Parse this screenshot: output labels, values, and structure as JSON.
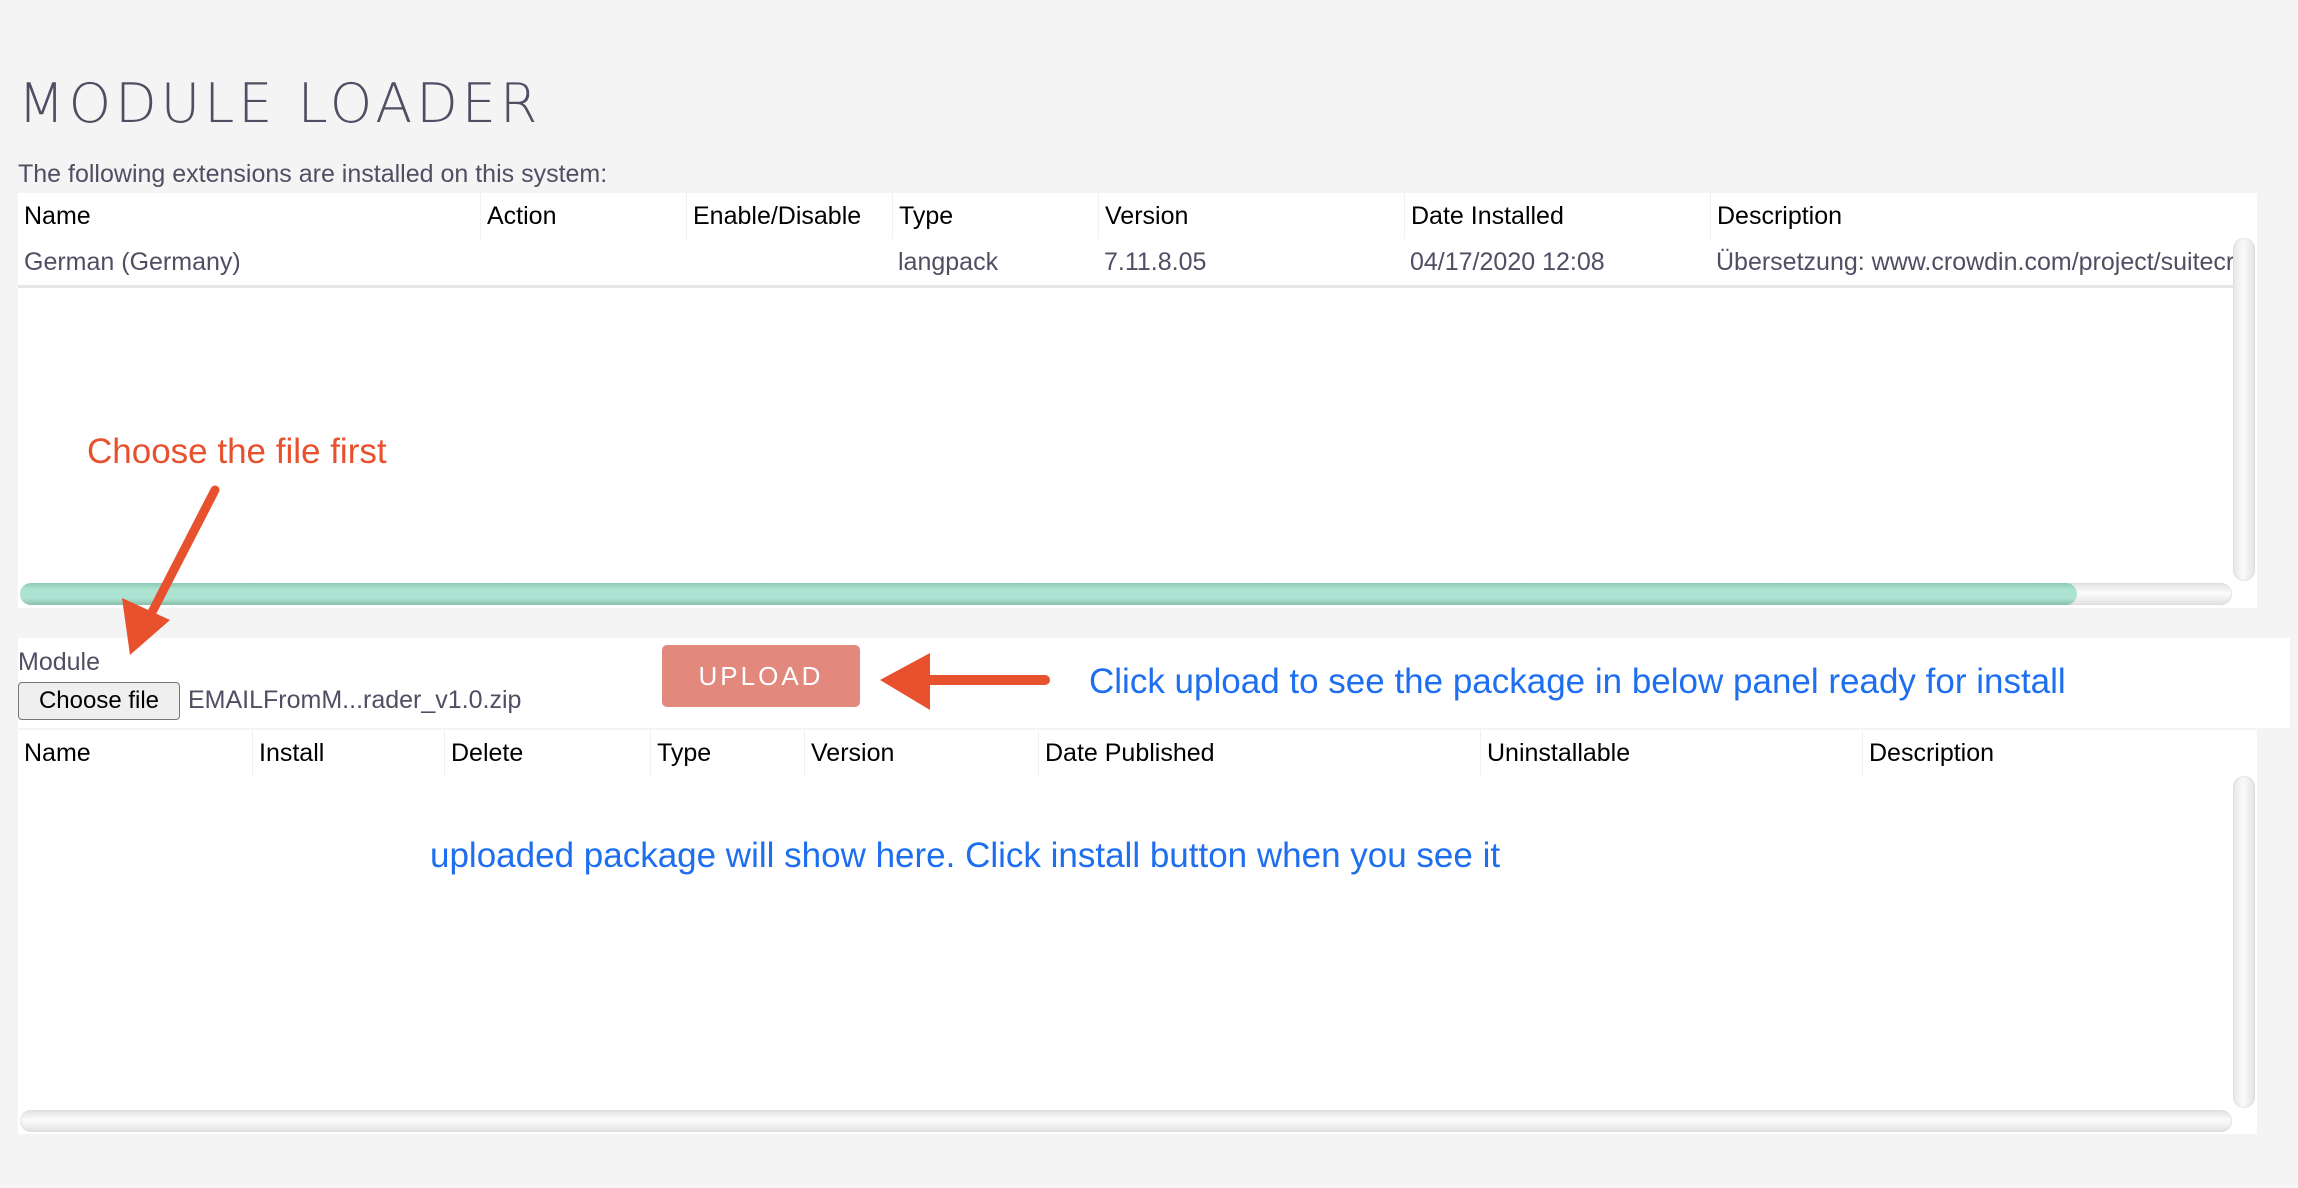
{
  "page": {
    "title": "MODULE LOADER",
    "subtitle": "The following extensions are installed on this system:"
  },
  "installed_table": {
    "columns": [
      "Name",
      "Action",
      "Enable/Disable",
      "Type",
      "Version",
      "Date Installed",
      "Description"
    ],
    "rows": [
      {
        "name": "German (Germany)",
        "action": "",
        "enable_disable": "",
        "type": "langpack",
        "version": "7.11.8.05",
        "date_installed": "04/17/2020 12:08",
        "description": "Übersetzung: www.crowdin.com/project/suitecrmtranslations"
      }
    ],
    "horizontal_scroll_fraction": 0.93
  },
  "upload": {
    "module_label": "Module",
    "choose_file_label": "Choose file",
    "file_name": "EMAILFromM...rader_v1.0.zip",
    "upload_label": "UPLOAD"
  },
  "packages_table": {
    "columns": [
      "Name",
      "Install",
      "Delete",
      "Type",
      "Version",
      "Date Published",
      "Uninstallable",
      "Description"
    ],
    "rows": []
  },
  "annotations": {
    "choose_file": "Choose the file first",
    "click_upload": "Click upload to see the package in below panel ready for install",
    "uploaded_package": "uploaded package will show here. Click install button when you see it"
  },
  "colors": {
    "annotation_red": "#e8512e",
    "annotation_blue": "#1e6ef0",
    "upload_button": "#e3887c",
    "scroll_thumb": "#ade3d2"
  }
}
